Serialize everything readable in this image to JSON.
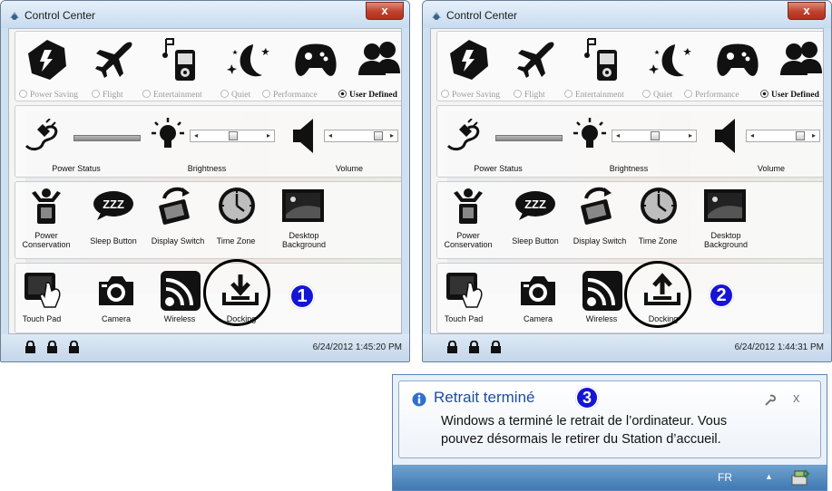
{
  "windows": [
    {
      "title": "Control Center",
      "close_label": "x",
      "modes": [
        {
          "label": "Power Saving",
          "selected": false
        },
        {
          "label": "Flight",
          "selected": false
        },
        {
          "label": "Entertainment",
          "selected": false
        },
        {
          "label": "Quiet",
          "selected": false
        },
        {
          "label": "Performance",
          "selected": false
        },
        {
          "label": "User Defined",
          "selected": true
        }
      ],
      "power_status_label": "Power Status",
      "brightness_label": "Brightness",
      "volume_label": "Volume",
      "tools": {
        "power_conservation": "Power Conservation",
        "sleep_button": "Sleep Button",
        "sleep_text": "ZZZ",
        "display_switch": "Display Switch",
        "time_zone": "Time Zone",
        "desktop_background": "Desktop Background"
      },
      "devices": {
        "touch_pad": "Touch Pad",
        "camera": "Camera",
        "wireless": "Wireless",
        "docking": "Docking"
      },
      "docking_arrow": "down",
      "timestamp": "6/24/2012 1:45:20 PM",
      "badge": "1"
    },
    {
      "title": "Control Center",
      "close_label": "x",
      "modes": [
        {
          "label": "Power Saving",
          "selected": false
        },
        {
          "label": "Flight",
          "selected": false
        },
        {
          "label": "Entertainment",
          "selected": false
        },
        {
          "label": "Quiet",
          "selected": false
        },
        {
          "label": "Performance",
          "selected": false
        },
        {
          "label": "User Defined",
          "selected": true
        }
      ],
      "power_status_label": "Power Status",
      "brightness_label": "Brightness",
      "volume_label": "Volume",
      "tools": {
        "power_conservation": "Power Conservation",
        "sleep_button": "Sleep Button",
        "sleep_text": "ZZZ",
        "display_switch": "Display Switch",
        "time_zone": "Time Zone",
        "desktop_background": "Desktop Background"
      },
      "devices": {
        "touch_pad": "Touch Pad",
        "camera": "Camera",
        "wireless": "Wireless",
        "docking": "Docking"
      },
      "docking_arrow": "up",
      "timestamp": "6/24/2012 1:44:31 PM",
      "badge": "2"
    }
  ],
  "notification": {
    "title": "Retrait terminé",
    "badge": "3",
    "message_line1": "Windows a terminé le retrait de l’ordinateur. Vous",
    "message_line2": "pouvez désormais le retirer du Station d’accueil.",
    "close_label": "x",
    "taskbar_language": "FR",
    "tray_arrow": "▲"
  },
  "colors": {
    "badge": "#1515d6",
    "title_link": "#1d4e9e",
    "close_button": "#c0412d"
  }
}
